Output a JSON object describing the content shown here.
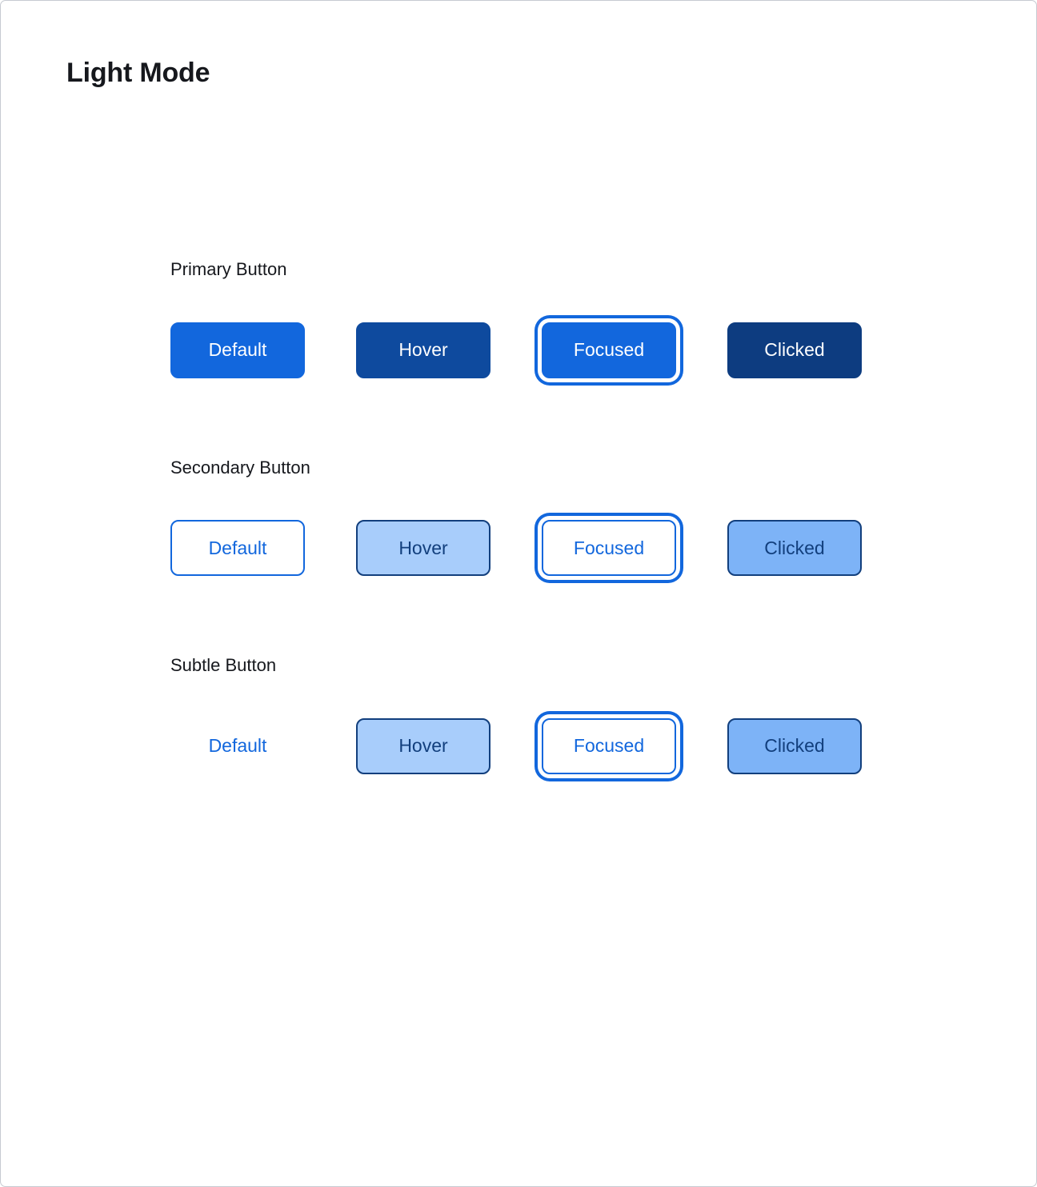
{
  "page": {
    "title": "Light Mode",
    "frame_border_color": "#c6cad1",
    "background_color": "#ffffff",
    "title_color": "#16181d"
  },
  "palette": {
    "accent_blue": "#1267dd",
    "accent_blue_dark": "#0e4a9e",
    "accent_blue_darkest": "#0d3c80",
    "accent_blue_light": "#a8cdfb",
    "accent_blue_mid": "#7db3f7",
    "text_on_light_blue": "#123f7d",
    "text_on_blue": "#ffffff"
  },
  "sections": [
    {
      "label": "Primary Button",
      "buttons": [
        {
          "label": "Default",
          "state": "default"
        },
        {
          "label": "Hover",
          "state": "hover"
        },
        {
          "label": "Focused",
          "state": "focused"
        },
        {
          "label": "Clicked",
          "state": "clicked"
        }
      ]
    },
    {
      "label": "Secondary Button",
      "buttons": [
        {
          "label": "Default",
          "state": "default"
        },
        {
          "label": "Hover",
          "state": "hover"
        },
        {
          "label": "Focused",
          "state": "focused"
        },
        {
          "label": "Clicked",
          "state": "clicked"
        }
      ]
    },
    {
      "label": "Subtle Button",
      "buttons": [
        {
          "label": "Default",
          "state": "default"
        },
        {
          "label": "Hover",
          "state": "hover"
        },
        {
          "label": "Focused",
          "state": "focused"
        },
        {
          "label": "Clicked",
          "state": "clicked"
        }
      ]
    }
  ]
}
